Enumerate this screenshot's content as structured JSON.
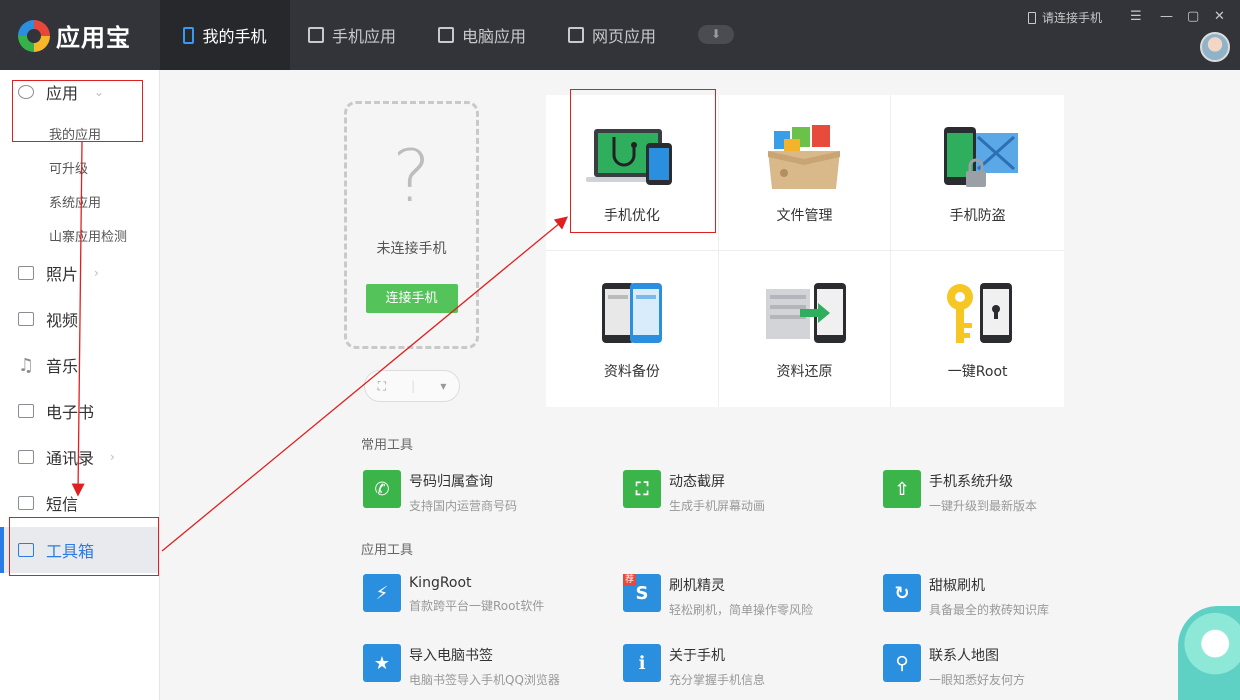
{
  "app": {
    "name": "应用宝"
  },
  "tabs": [
    {
      "label": "我的手机",
      "active": true
    },
    {
      "label": "手机应用"
    },
    {
      "label": "电脑应用"
    },
    {
      "label": "网页应用"
    }
  ],
  "header": {
    "connect_label": "请连接手机"
  },
  "sidebar": {
    "items": [
      {
        "label": "应用"
      },
      {
        "label": "照片"
      },
      {
        "label": "视频"
      },
      {
        "label": "音乐"
      },
      {
        "label": "电子书"
      },
      {
        "label": "通讯录"
      },
      {
        "label": "短信"
      },
      {
        "label": "工具箱",
        "active": true
      }
    ],
    "sub_items": [
      {
        "label": "我的应用"
      },
      {
        "label": "可升级"
      },
      {
        "label": "系统应用"
      },
      {
        "label": "山寨应用检测"
      }
    ]
  },
  "phone_panel": {
    "question": "?",
    "status": "未连接手机",
    "connect_button": "连接手机"
  },
  "feature_grid": [
    {
      "label": "手机优化"
    },
    {
      "label": "文件管理"
    },
    {
      "label": "手机防盗"
    },
    {
      "label": "资料备份"
    },
    {
      "label": "资料还原"
    },
    {
      "label": "一键Root"
    }
  ],
  "common_tools": {
    "title": "常用工具",
    "items": [
      {
        "name": "号码归属查询",
        "desc": "支持国内运营商号码"
      },
      {
        "name": "动态截屏",
        "desc": "生成手机屏幕动画"
      },
      {
        "name": "手机系统升级",
        "desc": "一键升级到最新版本"
      }
    ]
  },
  "app_tools": {
    "title": "应用工具",
    "items": [
      {
        "name": "KingRoot",
        "desc": "首款跨平台一键Root软件"
      },
      {
        "name": "刷机精灵",
        "desc": "轻松刷机，简单操作零风险",
        "badge": "荐"
      },
      {
        "name": "甜椒刷机",
        "desc": "具备最全的救砖知识库"
      },
      {
        "name": "导入电脑书签",
        "desc": "电脑书签导入手机QQ浏览器"
      },
      {
        "name": "关于手机",
        "desc": "充分掌握手机信息"
      },
      {
        "name": "联系人地图",
        "desc": "一眼知悉好友何方"
      }
    ]
  },
  "colors": {
    "accent": "#2a7be4",
    "topbar": "#323439",
    "green": "#3bb44a",
    "blue": "#2b8fe0",
    "annotation": "#e02020"
  }
}
